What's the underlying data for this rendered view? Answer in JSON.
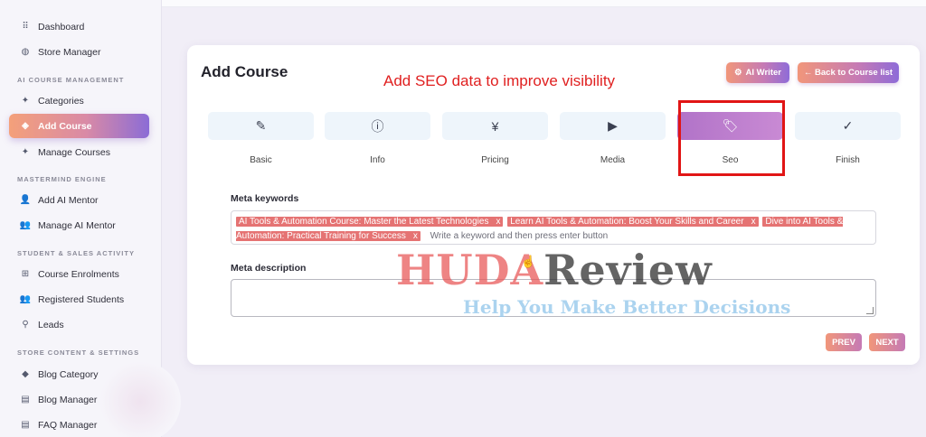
{
  "sidebar": {
    "items": [
      {
        "label": "Dashboard",
        "icon": "grid-icon"
      },
      {
        "label": "Store Manager",
        "icon": "globe-icon"
      },
      {
        "label": "Categories",
        "icon": "bulb-icon"
      },
      {
        "label": "Add Course",
        "icon": "basket-icon",
        "active": true
      },
      {
        "label": "Manage Courses",
        "icon": "bulb-icon"
      },
      {
        "label": "Add AI Mentor",
        "icon": "user-plus-icon"
      },
      {
        "label": "Manage AI Mentor",
        "icon": "users-icon"
      },
      {
        "label": "Course Enrolments",
        "icon": "sitemap-icon"
      },
      {
        "label": "Registered Students",
        "icon": "users-icon"
      },
      {
        "label": "Leads",
        "icon": "user-search-icon"
      },
      {
        "label": "Blog Category",
        "icon": "tag-icon"
      },
      {
        "label": "Blog Manager",
        "icon": "document-icon"
      },
      {
        "label": "FAQ Manager",
        "icon": "document-icon"
      }
    ],
    "headings": [
      "AI COURSE MANAGEMENT",
      "MASTERMIND ENGINE",
      "STUDENT & SALES ACTIVITY",
      "STORE CONTENT & SETTINGS"
    ]
  },
  "main": {
    "title": "Add Course",
    "annotation": "Add SEO data to improve visibility",
    "ai_writer_label": "AI Writer",
    "back_label": "← Back to Course list",
    "steps": [
      {
        "label": "Basic",
        "icon": "pen-icon"
      },
      {
        "label": "Info",
        "icon": "info-icon"
      },
      {
        "label": "Pricing",
        "icon": "yen-icon"
      },
      {
        "label": "Media",
        "icon": "media-icon"
      },
      {
        "label": "Seo",
        "icon": "tags-icon",
        "active": true
      },
      {
        "label": "Finish",
        "icon": "check-circle-icon"
      }
    ],
    "meta_keywords_label": "Meta keywords",
    "keywords": [
      "AI Tools & Automation Course: Master the Latest Technologies",
      "Learn AI Tools & Automation: Boost Your Skills and Career",
      "Dive into AI Tools & Automation: Practical Training for Success"
    ],
    "keyword_remove": "x",
    "keyword_placeholder": "Write a keyword and then press enter button",
    "meta_description_label": "Meta description",
    "meta_description_value": "",
    "prev_label": "PREV",
    "next_label": "NEXT"
  },
  "watermark": {
    "huda": "HUDA",
    "review": "Review",
    "tagline": "Help You Make Better Decisions"
  },
  "colors": {
    "accent_gradient_start": "#f1967a",
    "accent_gradient_end": "#8e6cd8",
    "active_step": "#b173c8",
    "tag_bg": "#e57373",
    "annotation_red": "#e02020"
  }
}
